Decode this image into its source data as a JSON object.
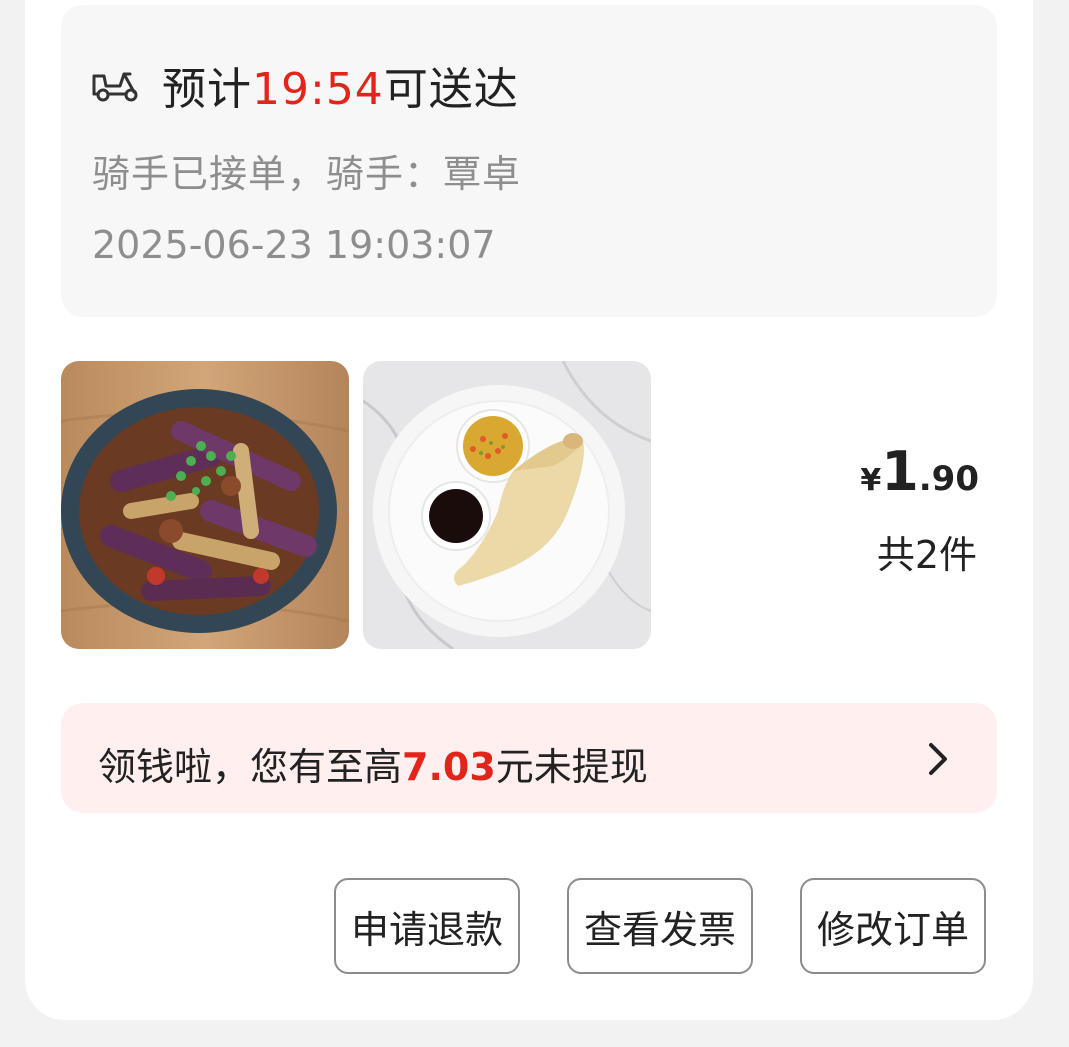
{
  "delivery": {
    "icon": "scooter-icon",
    "eta_prefix": "预计",
    "eta_time": "19:54",
    "eta_suffix": "可送达",
    "rider_status": "骑手已接单，骑手：覃卓",
    "order_time": "2025-06-23 19:03:07"
  },
  "order": {
    "items": [
      {
        "image": "braised-eggplant-photo"
      },
      {
        "image": "steamed-chicken-leg-photo"
      }
    ],
    "price_currency": "¥",
    "price_integer": "1",
    "price_decimal": ".90",
    "item_count": "共2件"
  },
  "promo": {
    "text_before": "领钱啦，您有至高",
    "amount": "7.03",
    "text_after": "元未提现",
    "icon": "chevron-right-icon"
  },
  "actions": {
    "refund_label": "申请退款",
    "invoice_label": "查看发票",
    "modify_label": "修改订单"
  },
  "colors": {
    "accent_red": "#e1251b",
    "promo_bg": "#fff0ef",
    "status_bg": "#f7f7f7"
  }
}
